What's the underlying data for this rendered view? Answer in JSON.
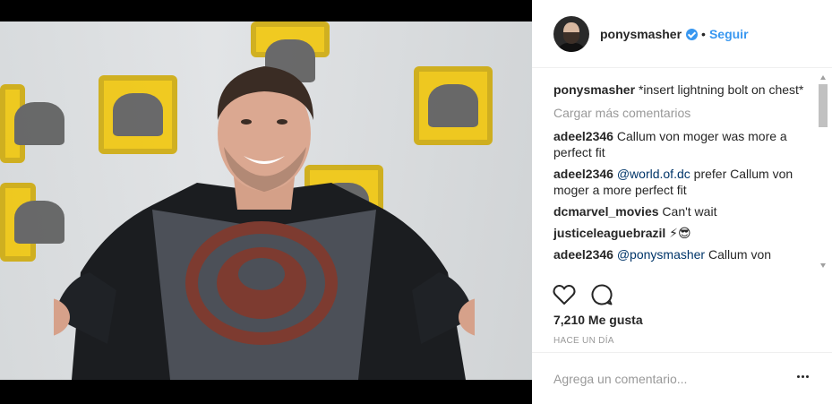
{
  "post": {
    "author": "ponysmasher",
    "follow_label": "Seguir",
    "separator": "•",
    "caption": {
      "user": "ponysmasher",
      "text": "*insert lightning bolt on chest*"
    },
    "load_more": "Cargar más comentarios",
    "comments": [
      {
        "user": "adeel2346",
        "mention": "",
        "text": "Callum von moger was more a perfect fit"
      },
      {
        "user": "adeel2346",
        "mention": "@world.of.dc",
        "text": "prefer Callum von moger a more perfect fit"
      },
      {
        "user": "dcmarvel_movies",
        "mention": "",
        "text": "Can't wait"
      },
      {
        "user": "justiceleaguebrazil",
        "mention": "",
        "text": "⚡😎"
      },
      {
        "user": "adeel2346",
        "mention": "@ponysmasher",
        "text": "Callum von"
      }
    ],
    "likes": "7,210 Me gusta",
    "time": "HACE UN DÍA",
    "comment_placeholder": "Agrega un comentario..."
  },
  "colors": {
    "link_blue": "#3897f0",
    "mention_blue": "#003569",
    "muted_gray": "#999999",
    "text": "#262626"
  },
  "icons": [
    "verified-icon",
    "heart-icon",
    "comment-icon",
    "more-options-icon"
  ]
}
